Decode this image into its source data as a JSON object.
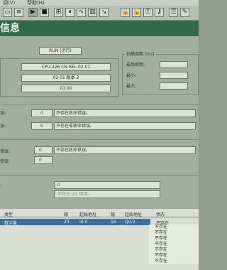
{
  "menu": {
    "item1": "调(V)",
    "item2": "帮助(H)"
  },
  "title": "信息",
  "run_mode": "RUN (运行)",
  "cpu": {
    "model": "CPU 226 CN REL 02.01",
    "version": "02 01 版本 2",
    "subversion": "01.00"
  },
  "scan": {
    "group_title": "扫描周期 (ms)",
    "last_label": "最后刷新:",
    "min_label": "最小:",
    "max_label": "最大:"
  },
  "errors": {
    "fatal": {
      "label": "误:",
      "count": "0",
      "message": "不存在致命错误。"
    },
    "nonfatal": {
      "label": "误:",
      "count": "0",
      "message": "不存在非致命错误。"
    },
    "last_fatal": {
      "label": "错误:",
      "count": "0",
      "message": "不存在致命错误。"
    },
    "total_fatal": {
      "label": "错误:",
      "count": "0"
    }
  },
  "io": {
    "label": ":",
    "count": "0",
    "message": "不存在 I/O 错误。"
  },
  "table": {
    "headers": [
      "类型",
      "输",
      "起始地址",
      "输",
      "起始地址",
      "状态"
    ],
    "selected_row": [
      "数字量",
      "24",
      "I0.0",
      "16",
      "Q0.0",
      "不存在"
    ],
    "statuses": [
      "不存在",
      "不存在",
      "不存在",
      "不存在",
      "不存在",
      "不存在",
      "不存在"
    ]
  }
}
